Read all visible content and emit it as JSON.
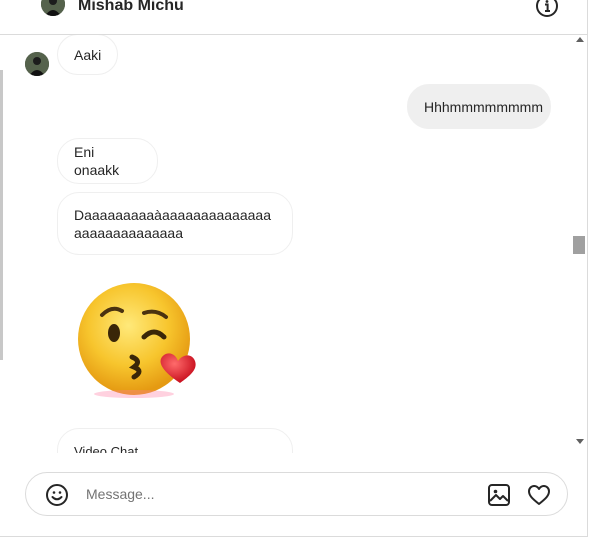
{
  "header": {
    "contact_name": "Mishab Michu",
    "info_icon": "info-icon",
    "avatar_icon": "profile-photo"
  },
  "messages": [
    {
      "direction": "incoming",
      "text": "Aaki"
    },
    {
      "direction": "outgoing",
      "text": "Hhhmmmmmmmm"
    },
    {
      "direction": "incoming",
      "text": "Eni onaakk"
    },
    {
      "direction": "incoming",
      "text": "Daaaaaaaaaàaaaaaaaaaaaaaaaaaaaaaaaaaaaa"
    },
    {
      "direction": "incoming",
      "type": "emoji",
      "emoji": "face-blowing-a-kiss"
    },
    {
      "direction": "incoming",
      "text": "Video Chat"
    }
  ],
  "composer": {
    "placeholder": "Message...",
    "value": "",
    "emoji_icon": "smile-icon",
    "image_icon": "image-icon",
    "like_icon": "heart-icon"
  },
  "colors": {
    "outgoing_bubble": "#efefef",
    "border": "#dbdbdb",
    "text": "#262626",
    "placeholder": "#737373"
  }
}
